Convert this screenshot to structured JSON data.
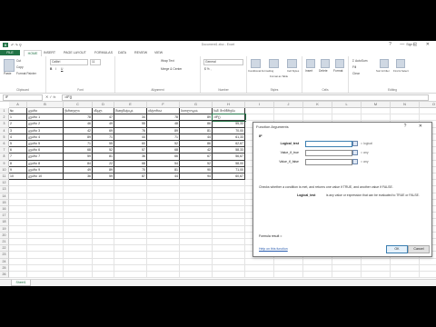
{
  "window": {
    "title": "Document1.xlsx - Excel",
    "sign_in": "Sign in",
    "app_icon": "excel-icon",
    "controls": "?  —  ▢  ✕"
  },
  "qat": "↶ ↷ ⚲",
  "tabs": [
    "FILE",
    "HOME",
    "INSERT",
    "PAGE LAYOUT",
    "FORMULAS",
    "DATA",
    "REVIEW",
    "VIEW"
  ],
  "active_tab": "HOME",
  "ribbon": {
    "clipboard": {
      "label": "Clipboard",
      "paste": "Paste",
      "cut": "Cut",
      "copy": "Copy",
      "format_painter": "Format Painter"
    },
    "font": {
      "label": "Font",
      "name": "Calibri",
      "size": "11",
      "bold": "B",
      "italic": "I",
      "underline": "U"
    },
    "alignment": {
      "label": "Alignment",
      "wrap": "Wrap Text",
      "merge": "Merge & Center"
    },
    "number": {
      "label": "Number",
      "format": "General",
      "symbols": "$ % ,"
    },
    "styles": {
      "label": "Styles",
      "conditional": "Conditional Formatting",
      "table": "Format as Table",
      "cell_styles": "Cell Styles"
    },
    "cells": {
      "label": "Cells",
      "insert": "Insert",
      "delete": "Delete",
      "format": "Format"
    },
    "editing": {
      "label": "Editing",
      "autosum": "AutoSum",
      "fill": "Fill",
      "clear": "Clear",
      "sort": "Sort & Filter",
      "find": "Find & Select"
    }
  },
  "formula_bar": {
    "name_box": "IF",
    "icons": "✕ ✓ fx",
    "formula": "=IF()"
  },
  "columns": [
    "A",
    "B",
    "C",
    "D",
    "E",
    "F",
    "G",
    "H",
    "I",
    "J",
    "K",
    "L",
    "M",
    "N",
    "O"
  ],
  "rows": [
    "1",
    "2",
    "3",
    "4",
    "5",
    "6",
    "7",
    "8",
    "9",
    "10",
    "11",
    "12",
    "13",
    "14",
    "15",
    "16",
    "17",
    "18",
    "19",
    "20",
    "21",
    "22",
    "23",
    "24",
    "25",
    "26"
  ],
  "table": {
    "headers": [
      "№",
      "გვარი",
      "ქართული",
      "ინგლ.",
      "მათემატიკა",
      "ისტორია",
      "ბიოლოგია",
      "საშ. მოსწრება"
    ],
    "body": [
      [
        "1",
        "გვარი 1",
        "78",
        "47",
        "34",
        "78",
        "89",
        "=IF()"
      ],
      [
        "2",
        "გვარი 2",
        "46",
        "49",
        "55",
        "48",
        "86",
        "55,33"
      ],
      [
        "3",
        "გვარი 3",
        "42",
        "69",
        "76",
        "89",
        "81",
        "70,00"
      ],
      [
        "4",
        "გვარი 4",
        "89",
        "71",
        "44",
        "71",
        "44",
        "61,33"
      ],
      [
        "5",
        "გვარი 5",
        "71",
        "55",
        "60",
        "52",
        "86",
        "62,67"
      ],
      [
        "6",
        "გვარი 6",
        "68",
        "52",
        "57",
        "68",
        "42",
        "58,33"
      ],
      [
        "7",
        "გვარი 7",
        "59",
        "81",
        "36",
        "66",
        "67",
        "56,67"
      ],
      [
        "8",
        "გვარი 8",
        "84",
        "22",
        "68",
        "54",
        "52",
        "58,00"
      ],
      [
        "9",
        "გვარი 9",
        "49",
        "89",
        "70",
        "81",
        "90",
        "71,00"
      ],
      [
        "10",
        "გვარი 10",
        "36",
        "59",
        "87",
        "44",
        "94",
        "60,67"
      ]
    ]
  },
  "dialog": {
    "title": "Function Arguments",
    "controls": "?  ✕",
    "function_name": "IF",
    "args": [
      {
        "label": "Logical_test",
        "result": "=  logical"
      },
      {
        "label": "Value_if_true",
        "result": "=  any"
      },
      {
        "label": "Value_if_false",
        "result": "=  any"
      }
    ],
    "description": "Checks whether a condition is met, and returns one value if TRUE, and another value if FALSE.",
    "arg_name": "Logical_test",
    "arg_description": "is any value or expression that can be evaluated to TRUE or FALSE.",
    "result_label": "Formula result =",
    "help_link": "Help on this function",
    "ok": "OK",
    "cancel": "Cancel"
  },
  "sheet_tab": "Sheet1",
  "colors": {
    "accent": "#217346",
    "link": "#2a5db0"
  }
}
